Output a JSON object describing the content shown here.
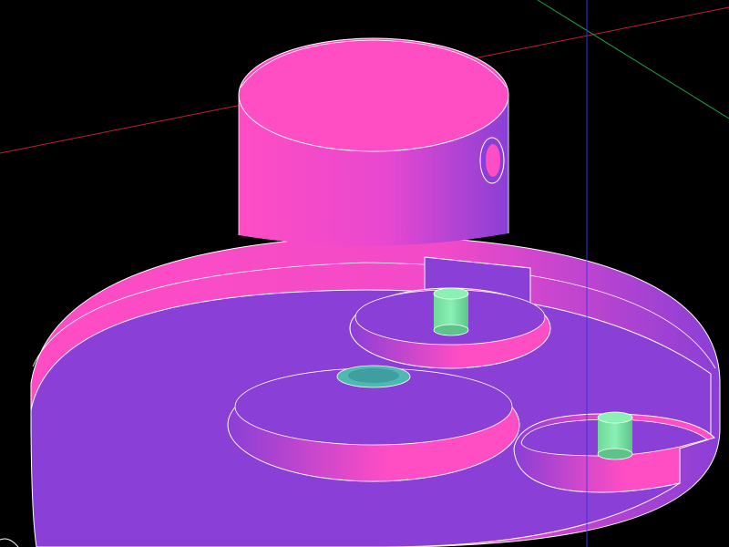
{
  "scene": {
    "background": "#000000",
    "body_color": "#ff4dc4",
    "face_color": "#8a3fd6",
    "pin_color": "#7de8a8",
    "hole_color": "#4fb8b0",
    "edge_color": "#ffffff",
    "axes": {
      "x_color": "#c0202c",
      "y_color": "#22a040",
      "z_color": "#3030e0"
    }
  }
}
